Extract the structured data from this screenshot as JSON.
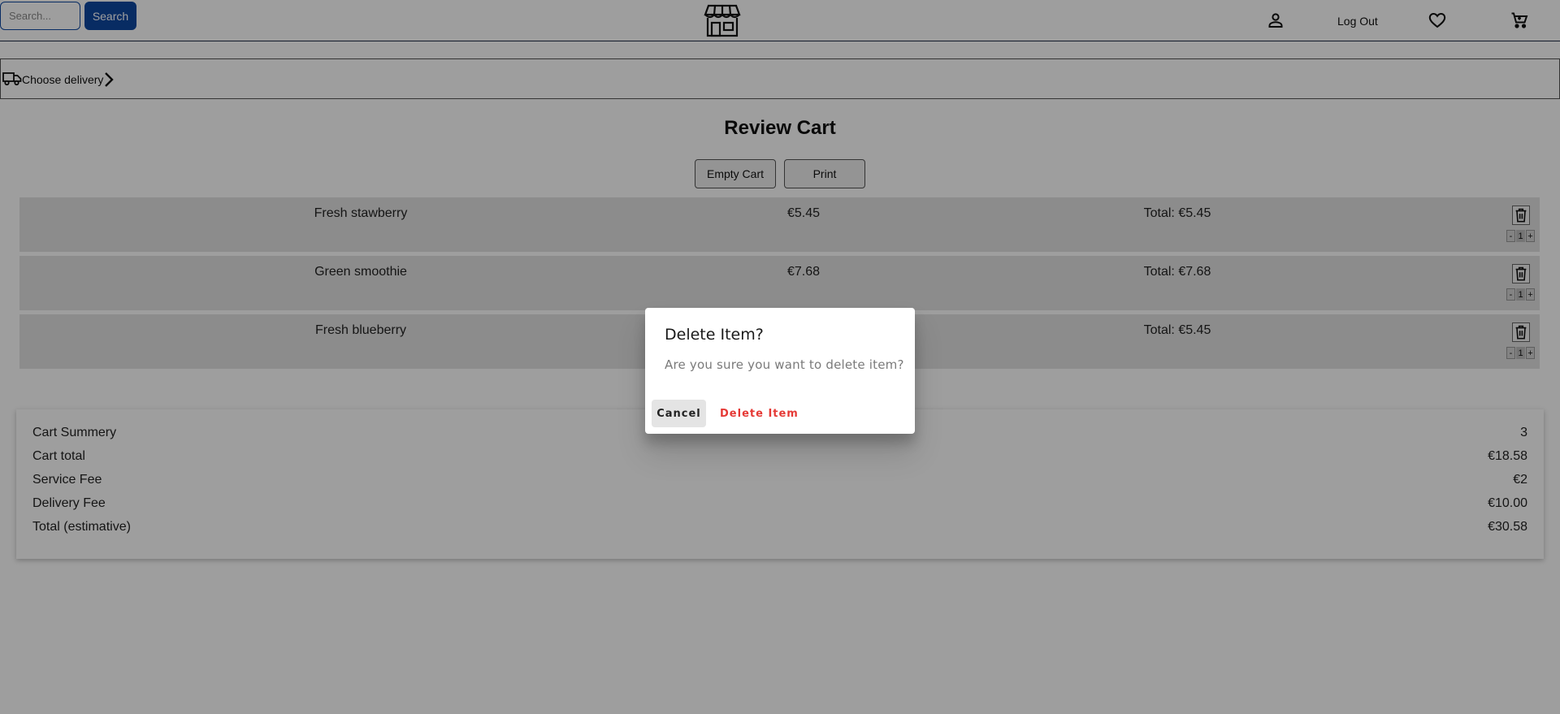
{
  "header": {
    "search_placeholder": "Search...",
    "search_button": "Search",
    "logout_label": "Log Out",
    "icons": [
      "store-icon",
      "user-icon",
      "heart-icon",
      "cart-icon"
    ]
  },
  "delivery": {
    "label": "Choose delivery",
    "icons": [
      "truck-icon",
      "chevron-right-icon"
    ]
  },
  "main": {
    "title": "Review Cart",
    "empty_cart_label": "Empty Cart",
    "print_label": "Print",
    "items": [
      {
        "name": "Fresh stawberry",
        "price": "€5.45",
        "total": "Total: €5.45",
        "qty": "1",
        "minus": "-",
        "plus": "+"
      },
      {
        "name": "Green smoothie",
        "price": "€7.68",
        "total": "Total: €7.68",
        "qty": "1",
        "minus": "-",
        "plus": "+"
      },
      {
        "name": "Fresh blueberry",
        "price": "",
        "total": "Total: €5.45",
        "qty": "1",
        "minus": "-",
        "plus": "+"
      }
    ]
  },
  "summary": {
    "rows": [
      {
        "label": "Cart Summery",
        "value": "3"
      },
      {
        "label": "Cart total",
        "value": "€18.58"
      },
      {
        "label": "Service Fee",
        "value": "€2"
      },
      {
        "label": "Delivery Fee",
        "value": "€10.00"
      },
      {
        "label": "Total (estimative)",
        "value": "€30.58"
      }
    ]
  },
  "dialog": {
    "title": "Delete Item?",
    "message": "Are you sure you want to delete item?",
    "cancel_label": "Cancel",
    "confirm_label": "Delete Item"
  },
  "colors": {
    "accent": "#0d47a1",
    "danger": "#e53935",
    "scrim": "rgba(0,0,0,0.38)"
  }
}
